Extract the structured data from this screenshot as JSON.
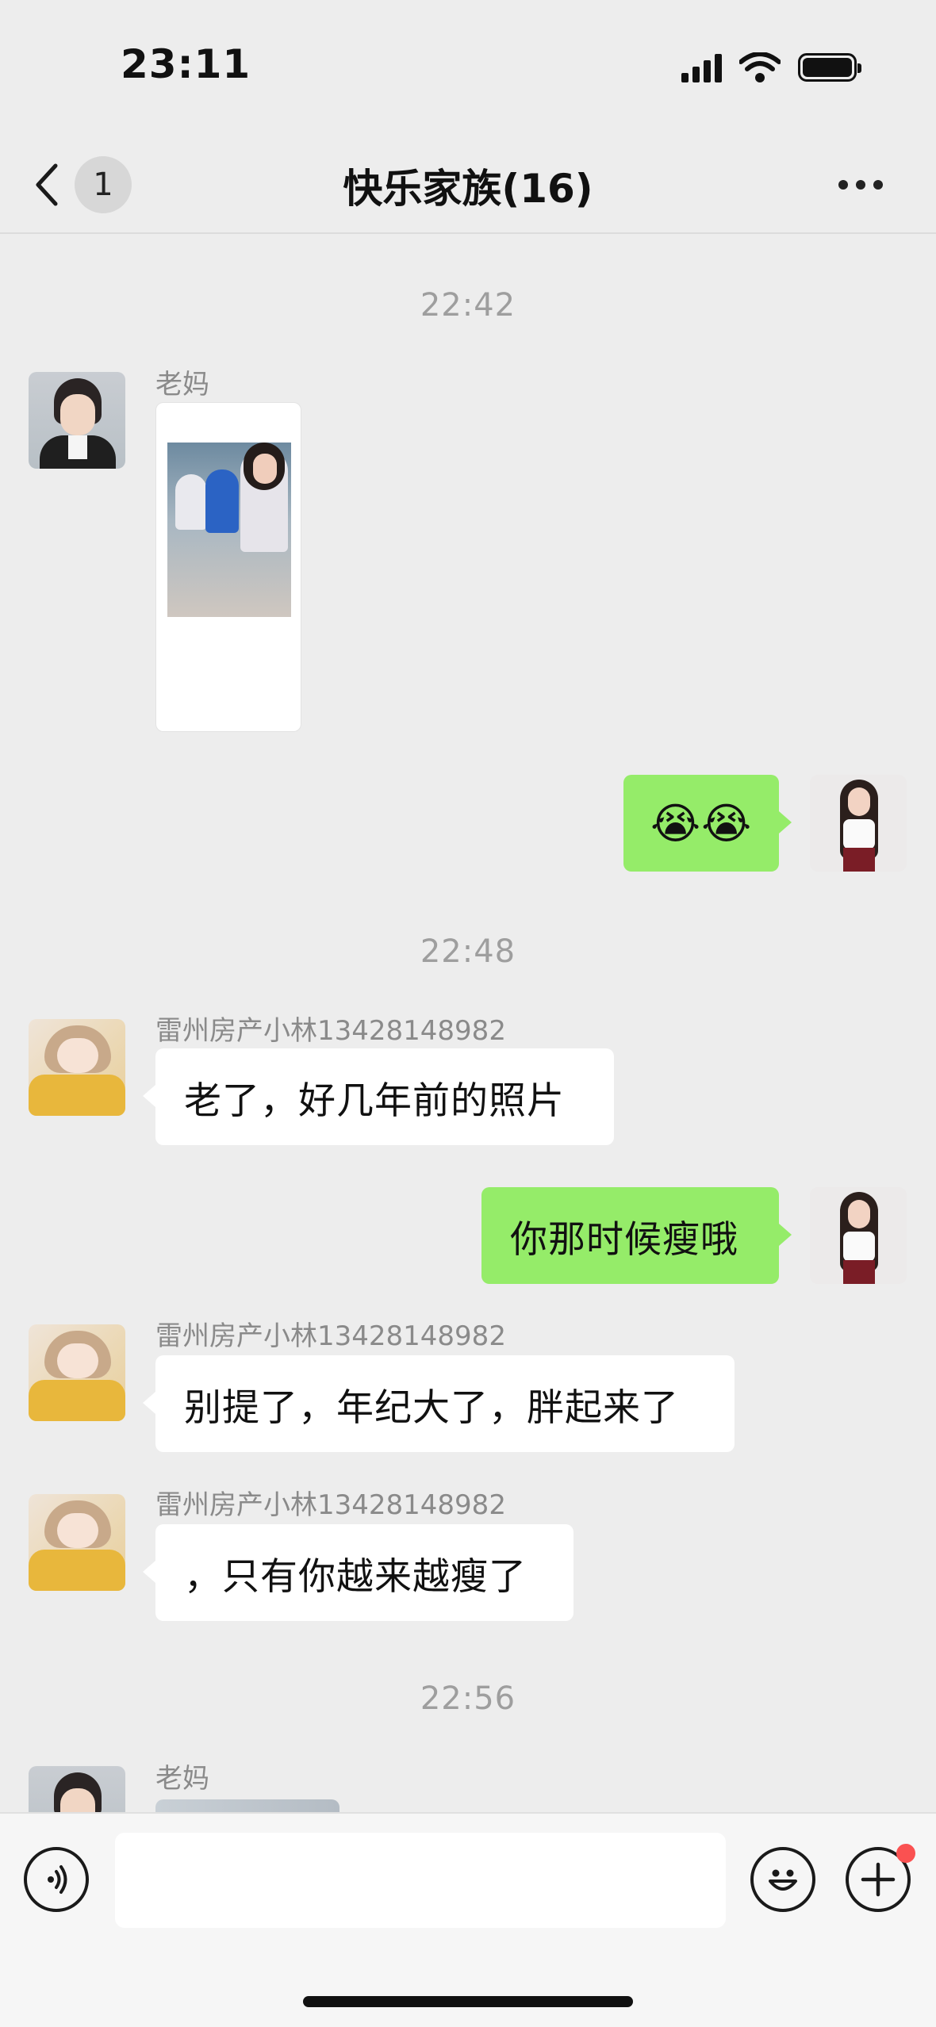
{
  "status_bar": {
    "time": "23:11"
  },
  "nav": {
    "back_badge": "1",
    "title": "快乐家族(16)"
  },
  "messages": {
    "ts1": "22:42",
    "m1_sender": "老妈",
    "m2_emoji": "😭😭",
    "ts2": "22:48",
    "m3_sender": "雷州房产小林13428148982",
    "m3_text": "老了，好几年前的照片",
    "m4_text": "你那时候瘦哦",
    "m5_sender": "雷州房产小林13428148982",
    "m5_text": "别提了，年纪大了，胖起来了",
    "m6_sender": "雷州房产小林13428148982",
    "m6_text": "，只有你越来越瘦了",
    "ts3": "22:56",
    "m7_sender": "老妈"
  },
  "input": {
    "value": ""
  },
  "colors": {
    "outgoing_bubble": "#95ec69",
    "incoming_bubble": "#ffffff",
    "background": "#ededed",
    "notification_dot": "#fa5151"
  },
  "icons": {
    "back": "chevron-left-icon",
    "more": "more-icon",
    "voice": "voice-icon",
    "emoji": "emoji-icon",
    "plus": "plus-icon"
  }
}
